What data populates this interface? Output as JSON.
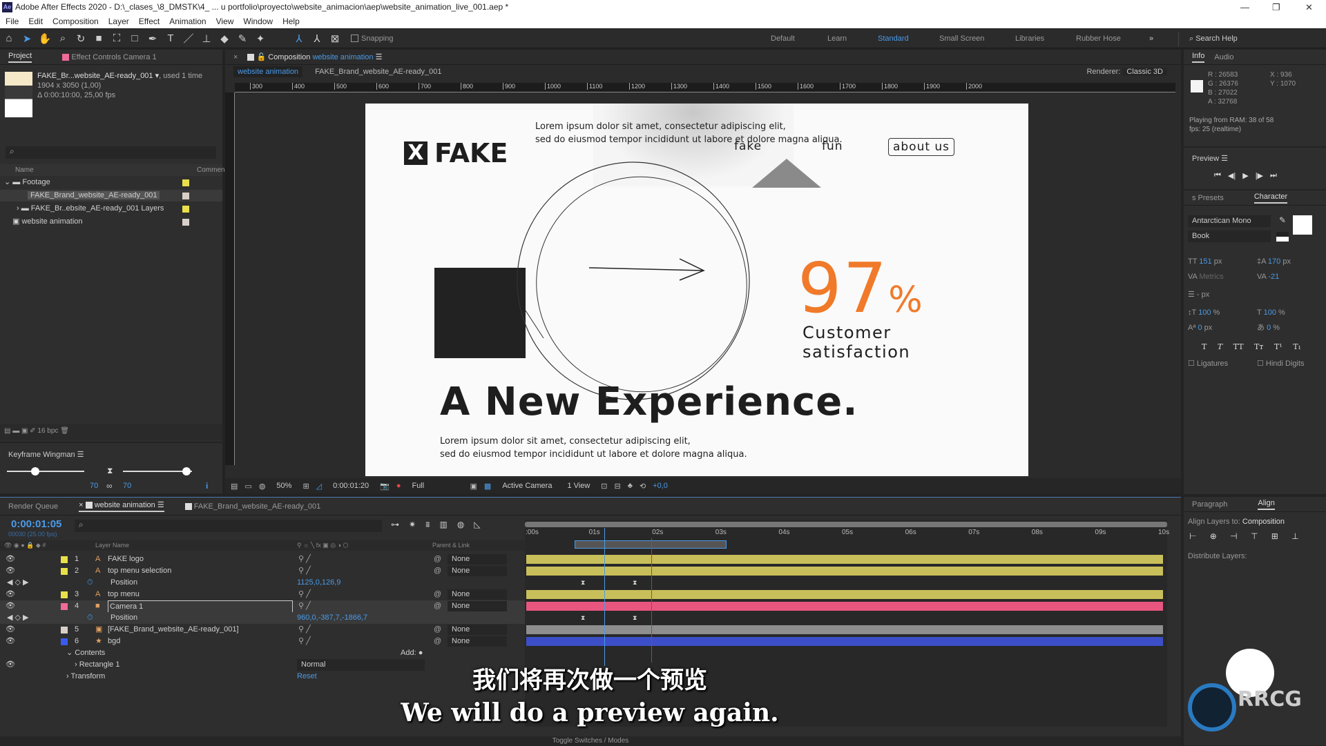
{
  "window": {
    "app_icon": "Ae",
    "title": "Adobe After Effects 2020 - D:\\_clases_\\8_DMSTK\\4_ ... u portfolio\\proyecto\\website_animacion\\aep\\website_animation_live_001.aep *"
  },
  "menu": [
    "File",
    "Edit",
    "Composition",
    "Layer",
    "Effect",
    "Animation",
    "View",
    "Window",
    "Help"
  ],
  "toolbar": {
    "snapping": "Snapping",
    "workspaces": [
      "Default",
      "Learn",
      "Standard",
      "Small Screen",
      "Libraries",
      "Rubber Hose"
    ],
    "active_workspace": "Standard",
    "search": "Search Help"
  },
  "project": {
    "tab": "Project",
    "tab2": "Effect Controls Camera 1",
    "item_name": "FAKE_Br...website_AE-ready_001",
    "used": ", used 1 time",
    "dims": "1904 x 3050 (1,00)",
    "duration": "Δ 0:00:10:00, 25,00 fps",
    "col_name": "Name",
    "col_comment": "Commen",
    "items": [
      {
        "name": "Footage",
        "type": "folder",
        "color": "#e8e04a"
      },
      {
        "name": "FAKE_Brand_website_AE-ready_001",
        "type": "footage",
        "color": "#d8d0c8"
      },
      {
        "name": "FAKE_Br..ebsite_AE-ready_001 Layers",
        "type": "folder",
        "color": "#e8e04a"
      },
      {
        "name": "website animation",
        "type": "comp",
        "color": "#d8d0c8"
      }
    ],
    "bpc": "16 bpc"
  },
  "wingman": {
    "title": "Keyframe Wingman",
    "left_value": "70",
    "right_value": "70"
  },
  "composition": {
    "tab_prefix": "Composition",
    "tab_name": "website animation",
    "crumbs": [
      "website animation",
      "FAKE_Brand_website_AE-ready_001"
    ],
    "renderer_label": "Renderer:",
    "renderer": "Classic 3D",
    "ruler": [
      "300",
      "400",
      "500",
      "600",
      "700",
      "800",
      "900",
      "1000",
      "1100",
      "1200",
      "1300",
      "1400",
      "1500",
      "1600",
      "1700",
      "1800",
      "1900",
      "2000"
    ],
    "footer": {
      "zoom": "50%",
      "time": "0:00:01:20",
      "resolution": "Full",
      "view": "Active Camera",
      "views": "1 View",
      "exposure": "+0,0"
    }
  },
  "artwork": {
    "lorem_top_1": "Lorem ipsum dolor sit amet, consectetur adipiscing elit,",
    "lorem_top_2": "sed do eiusmod tempor incididunt ut labore et dolore magna aliqua.",
    "logo": "FAKE",
    "nav": [
      "fake",
      "fun",
      "about us"
    ],
    "stat": "97",
    "stat_unit": "%",
    "stat_label_1": "Customer",
    "stat_label_2": "satisfaction",
    "headline": "A New Experience.",
    "lorem_bottom_1": "Lorem ipsum dolor sit amet, consectetur adipiscing elit,",
    "lorem_bottom_2": "sed do eiusmod tempor incididunt ut labore et dolore magna aliqua.",
    "accent": "#f07a2a"
  },
  "info": {
    "tab": "Info",
    "tab2": "Audio",
    "r": "R : 26583",
    "g": "G : 26376",
    "b": "B : 27022",
    "a": "A : 32768",
    "x": "X : 936",
    "y": "Y : 1070",
    "ram": "Playing from RAM: 38 of 58",
    "fps": "fps: 25 (realtime)"
  },
  "preview": {
    "title": "Preview"
  },
  "character": {
    "tab1": "s Presets",
    "tab2": "Character",
    "font": "Antarctican Mono",
    "style": "Book",
    "size": "151",
    "size_unit": "px",
    "leading": "170",
    "leading_unit": "px",
    "kerning": "Metrics",
    "tracking": "-21",
    "stroke": "- px",
    "vscale": "100",
    "hscale": "100",
    "pct": "%",
    "baseline": "0",
    "baseline_unit": "px",
    "tsume": "0",
    "ligatures": "Ligatures",
    "hindi": "Hindi Digits"
  },
  "align": {
    "tab1": "Paragraph",
    "tab2": "Align",
    "align_to_label": "Align Layers to:",
    "align_to": "Composition",
    "distribute": "Distribute Layers:"
  },
  "timeline": {
    "tabs": [
      "Render Queue",
      "website animation",
      "FAKE_Brand_website_AE-ready_001"
    ],
    "current_time": "0:00:01:05",
    "frame": "00030 (25.00 fps)",
    "col_layer": "Layer Name",
    "col_parent": "Parent & Link",
    "time_labels": [
      ":00s",
      "01s",
      "02s",
      "03s",
      "04s",
      "05s",
      "06s",
      "07s",
      "08s",
      "09s",
      "10s"
    ],
    "playhead_s": 1.2,
    "footer": "Toggle Switches / Modes",
    "layers": [
      {
        "num": "1",
        "name": "FAKE logo",
        "color": "#e8e04a",
        "bar": "#c9bf5a",
        "parent": "None",
        "icon": "text"
      },
      {
        "num": "2",
        "name": "top menu selection",
        "color": "#e8e04a",
        "bar": "#c9bf5a",
        "parent": "None",
        "icon": "text",
        "prop": {
          "name": "Position",
          "value": "1125,0,126,9"
        }
      },
      {
        "num": "3",
        "name": "top menu",
        "color": "#e8e04a",
        "bar": "#c9bf5a",
        "parent": "None",
        "icon": "text"
      },
      {
        "num": "4",
        "name": "Camera 1",
        "color": "#f06a9a",
        "bar": "#e8557f",
        "parent": "None",
        "icon": "camera",
        "prop": {
          "name": "Position",
          "value": "960,0,-387,7,-1866,7"
        }
      },
      {
        "num": "5",
        "name": "[FAKE_Brand_website_AE-ready_001]",
        "color": "#d8d0c8",
        "bar": "#8e8e8e",
        "parent": "None",
        "icon": "footage"
      },
      {
        "num": "6",
        "name": "bgd",
        "color": "#3a5af0",
        "bar": "#3c4fc8",
        "parent": "None",
        "icon": "star"
      }
    ],
    "contents": "Contents",
    "add": "Add:",
    "rect": "Rectangle 1",
    "blend": "Normal",
    "transform": "Transform",
    "reset": "Reset"
  },
  "subtitles": {
    "zh": "我们将再次做一个预览",
    "en": "We will do a preview again."
  },
  "watermark": "RRCG"
}
